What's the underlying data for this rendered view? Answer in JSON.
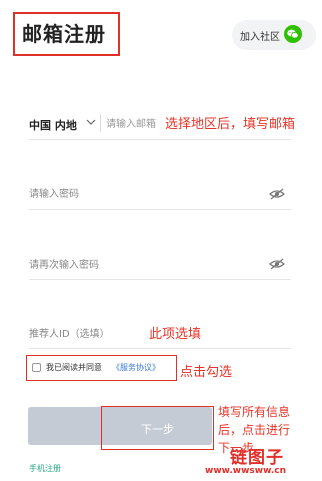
{
  "header": {
    "title": "邮箱注册",
    "community_label": "加入社区",
    "community_icon": "wechat-icon"
  },
  "form": {
    "region": "中国 内地",
    "email_placeholder": "请输入邮箱",
    "password_placeholder": "请输入密码",
    "confirm_password_placeholder": "请再次输入密码",
    "referral_placeholder": "推荐人ID（选填）",
    "agree_text": "我已阅读并同意",
    "agree_link": "《服务协议》",
    "next_label": "下一步",
    "phone_register": "手机注册"
  },
  "annotations": {
    "region_email": "选择地区后，填写邮箱",
    "referral": "此项选填",
    "agree": "点击勾选",
    "next_line1": "填写所有信息",
    "next_line2": "后，点击进行",
    "next_line3": "下一步"
  },
  "watermark": {
    "logo": "链图子",
    "url": "www.wwsww.cn"
  },
  "colors": {
    "annotation": "#e53427",
    "button_disabled": "#c4cbd4",
    "link": "#3a78d6",
    "wechat": "#2dc100",
    "phone_register": "#2aa888"
  }
}
